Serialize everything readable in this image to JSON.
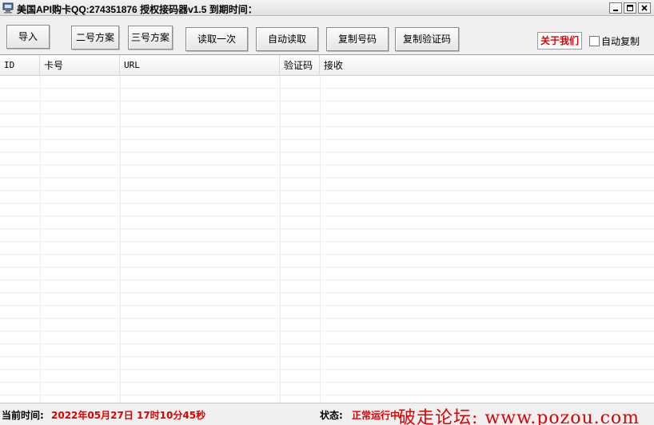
{
  "window": {
    "title": "美国API购卡QQ:274351876 授权接码器v1.5 到期时间：",
    "icons": {
      "app": "computer-icon",
      "minimize": "minimize-icon",
      "maximize": "maximize-icon",
      "close": "close-icon"
    }
  },
  "toolbar": {
    "import": "导入",
    "plan2": "二号方案",
    "plan3": "三号方案",
    "read_once": "读取一次",
    "auto_read": "自动读取",
    "copy_number": "复制号码",
    "copy_code": "复制验证码",
    "about": "关于我们",
    "auto_copy": "自动复制"
  },
  "table": {
    "columns": [
      "ID",
      "卡号",
      "URL",
      "验证码",
      "接收"
    ],
    "rows": []
  },
  "status": {
    "time_label": "当前时间:",
    "time_value": "2022年05月27日  17时10分45秒",
    "state_label": "状态:",
    "state_value": "正常运行中"
  },
  "watermark": "破走论坛: www.pozou.com",
  "colors": {
    "accent_red": "#e00000"
  }
}
